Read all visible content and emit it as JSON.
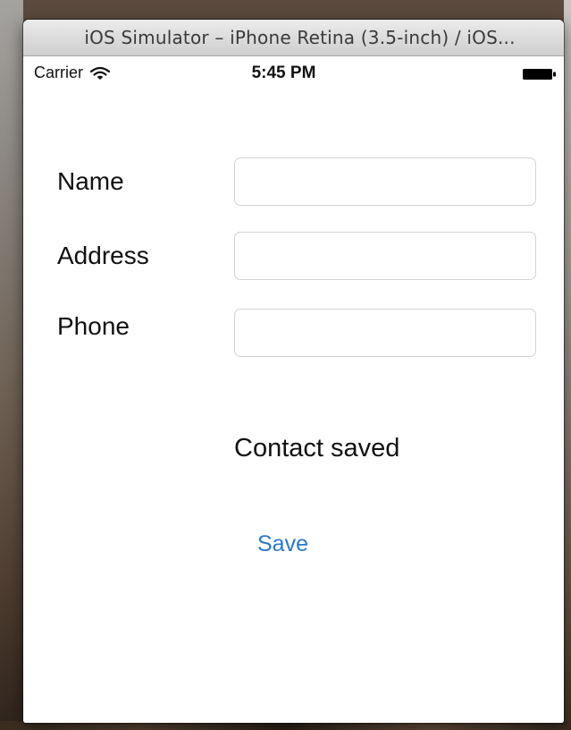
{
  "window": {
    "title": "iOS Simulator – iPhone Retina (3.5-inch) / iOS..."
  },
  "status_bar": {
    "carrier": "Carrier",
    "wifi_icon": "wifi-icon",
    "time": "5:45 PM",
    "battery_icon": "battery-icon"
  },
  "form": {
    "fields": [
      {
        "label": "Name",
        "value": "",
        "placeholder": ""
      },
      {
        "label": "Address",
        "value": "",
        "placeholder": ""
      },
      {
        "label": "Phone",
        "value": "",
        "placeholder": ""
      }
    ],
    "status_message": "Contact saved",
    "save_label": "Save"
  },
  "colors": {
    "accent": "#2a78c8",
    "text": "#111111",
    "field_border": "#d4d4d4"
  }
}
